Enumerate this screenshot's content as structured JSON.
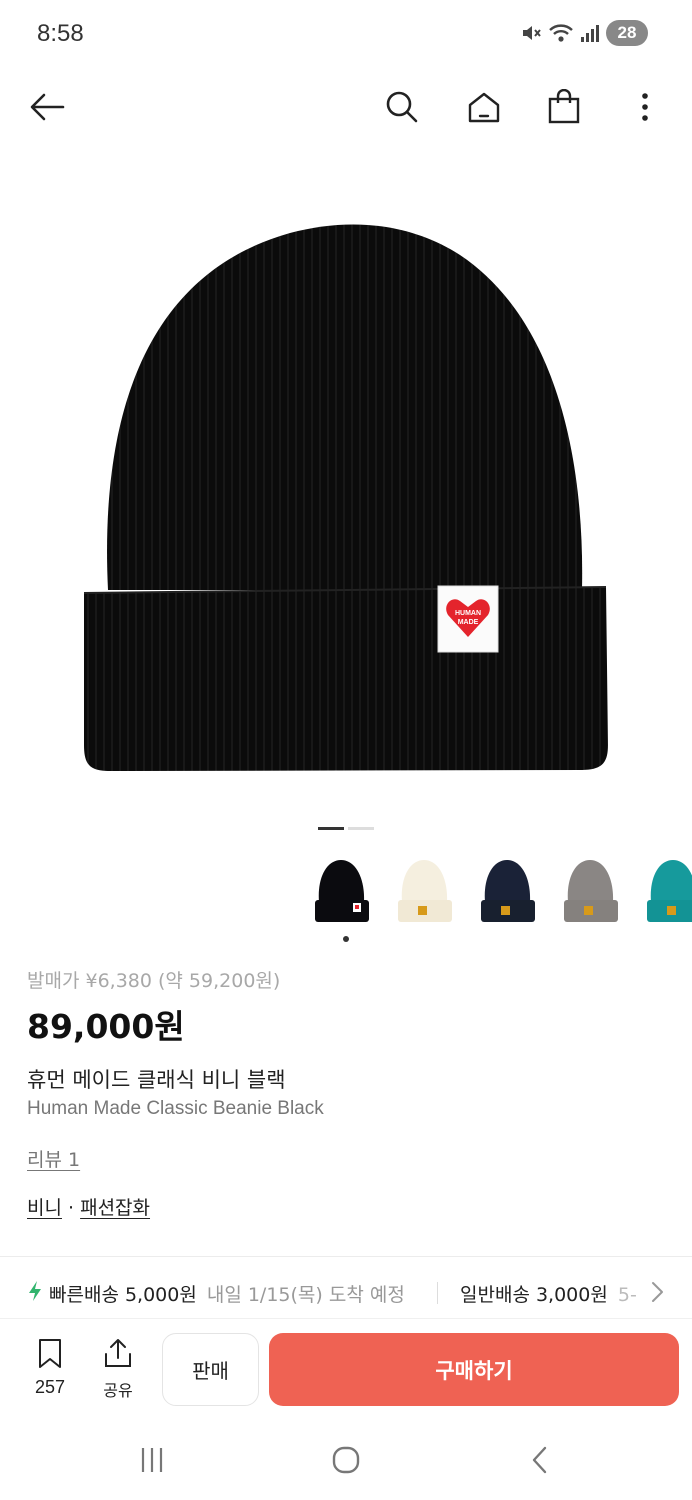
{
  "status_bar": {
    "time": "8:58",
    "battery": "28",
    "icons": [
      "mute-icon",
      "wifi-icon",
      "signal-icon",
      "battery-icon"
    ]
  },
  "header": {
    "icons": [
      "back-arrow-icon",
      "search-icon",
      "home-icon",
      "shopping-bag-icon",
      "more-vertical-icon"
    ]
  },
  "product_image": {
    "label_text": "HUMAN MADE",
    "color_primary": "#0a0a0a",
    "label_heart": "#e4242c"
  },
  "gallery": {
    "pages": 2,
    "active_page": 1
  },
  "variants": [
    {
      "name": "black",
      "color": "#0b0b0f",
      "selected": true
    },
    {
      "name": "cream",
      "color": "#f5efdf",
      "selected": false
    },
    {
      "name": "navy",
      "color": "#1a2237",
      "selected": false
    },
    {
      "name": "gray",
      "color": "#8a8684",
      "selected": false
    },
    {
      "name": "teal",
      "color": "#169a9c",
      "selected": false
    }
  ],
  "product": {
    "release_price": "발매가 ¥6,380 (약 59,200원)",
    "price": "89,000원",
    "name_ko": "휴먼 메이드 클래식 비니 블랙",
    "name_en": "Human Made Classic Beanie Black",
    "review": "리뷰 1",
    "category_1": "비니",
    "category_sep": " · ",
    "category_2": "패션잡화"
  },
  "shipping": {
    "fast_label": "빠른배송 5,000원",
    "fast_sub": "내일 1/15(목) 도착 예정",
    "normal_label": "일반배송 3,000원",
    "normal_sub": "5-"
  },
  "bottom_bar": {
    "bookmark_count": "257",
    "share_label": "공유",
    "sell_label": "판매",
    "buy_label": "구매하기",
    "buy_color": "#ef6253"
  },
  "nav_bar": {
    "icons": [
      "recent-apps-icon",
      "home-circle-icon",
      "back-chevron-icon"
    ]
  }
}
